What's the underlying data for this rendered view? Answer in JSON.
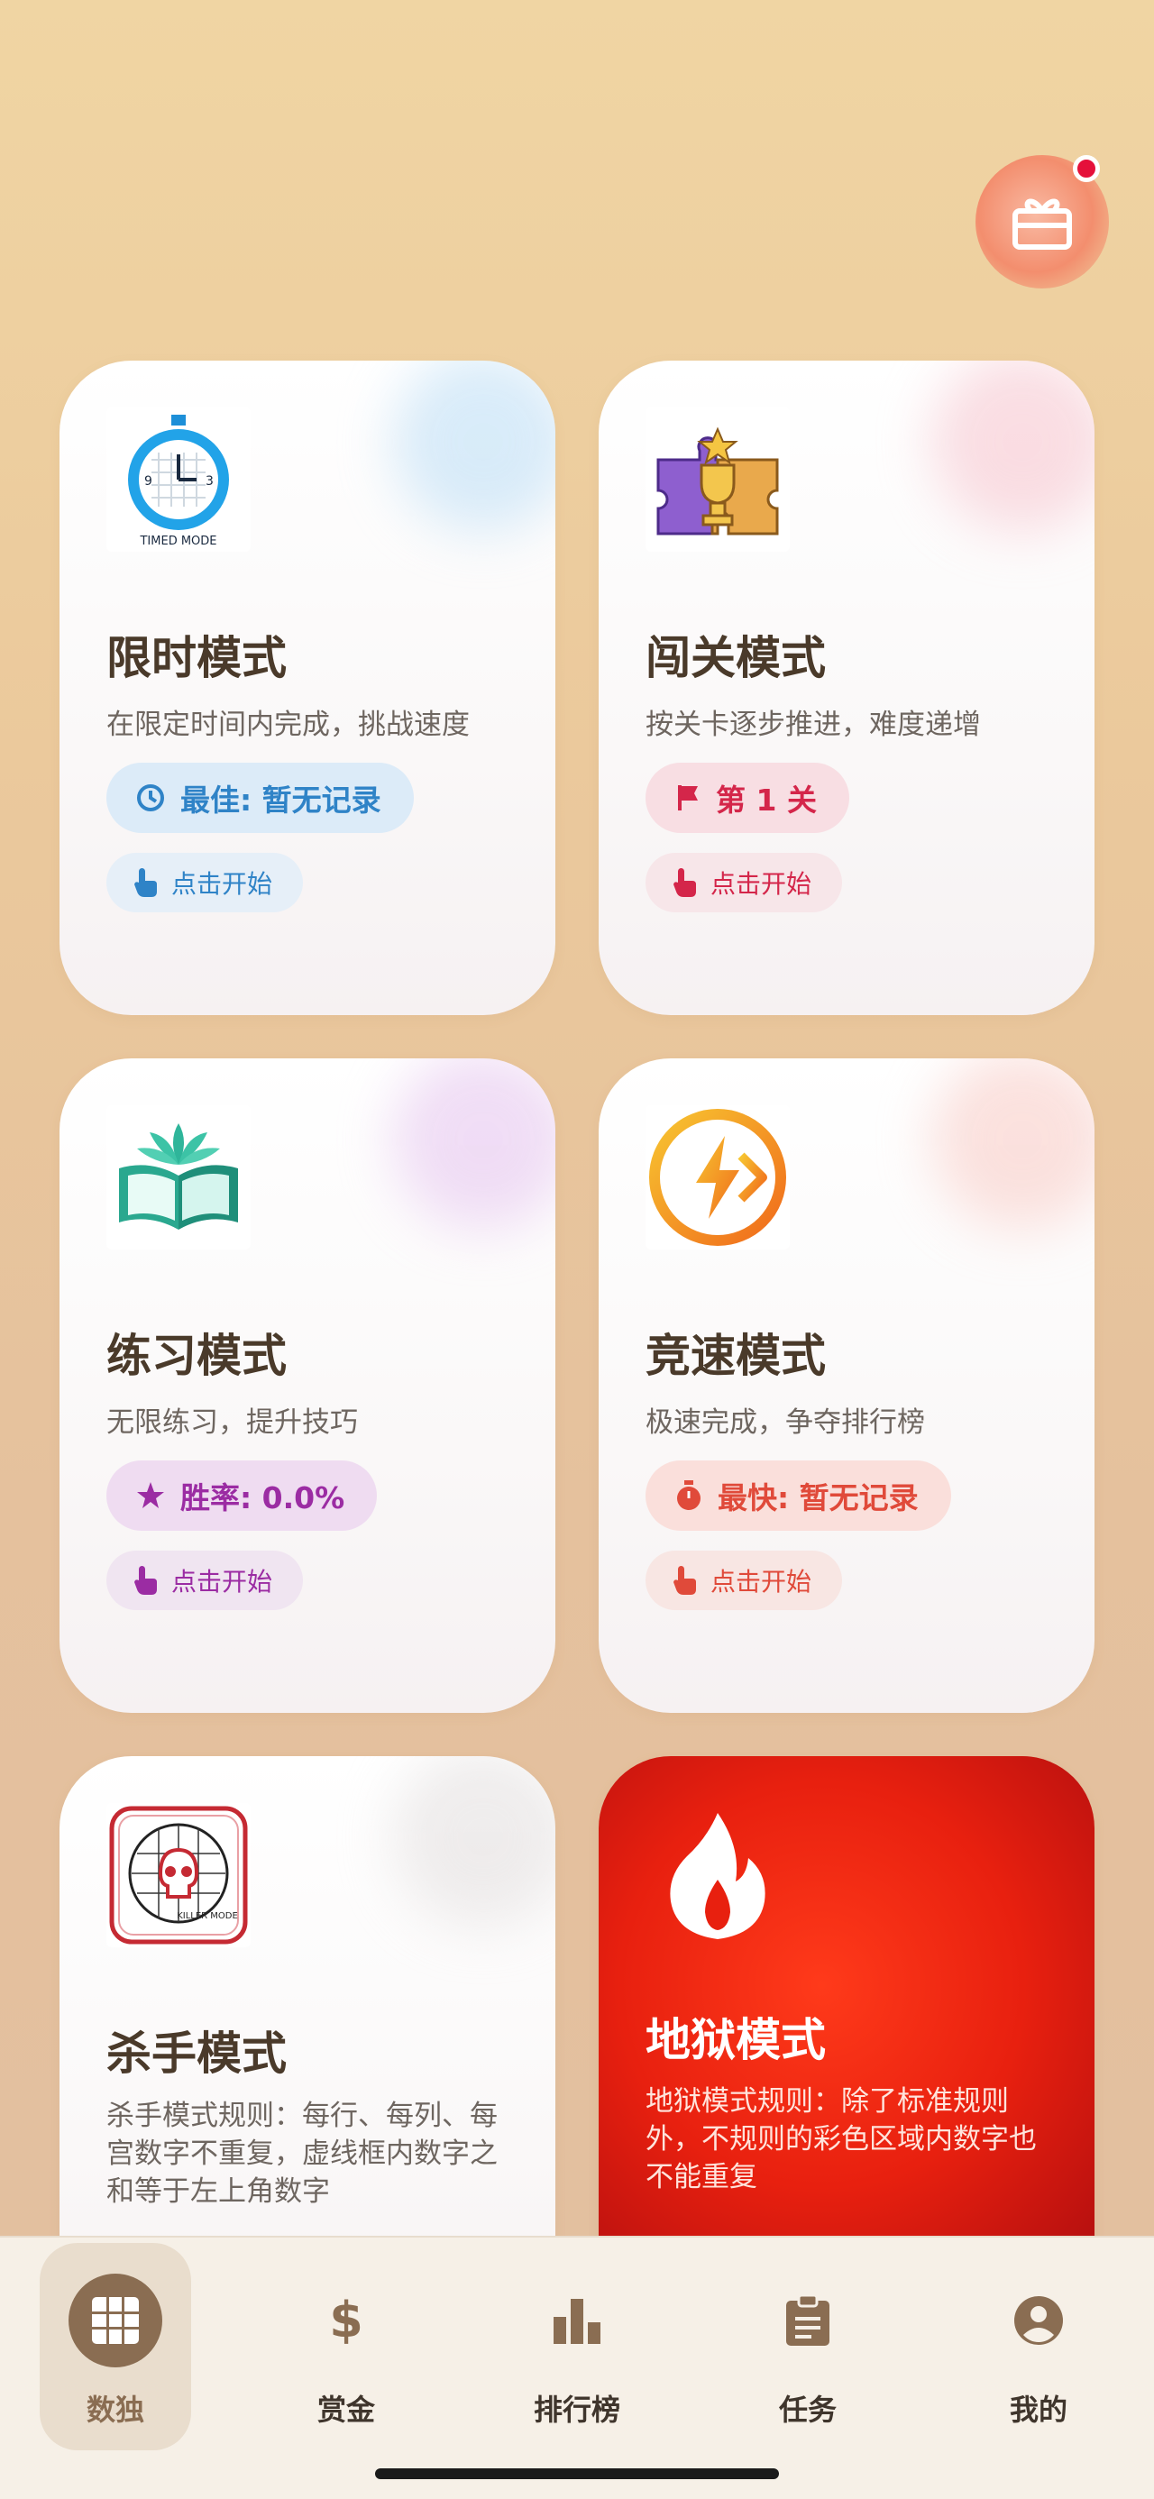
{
  "gift": {
    "icon": "gift-icon",
    "badge_color": "#e5103a"
  },
  "modes": [
    {
      "title": "限时模式",
      "desc": "在限定时间内完成，挑战速度",
      "badge": "最佳: 暂无记录",
      "badge_icon": "clock-icon",
      "start": "点击开始",
      "icon": "stopwatch-grid-icon",
      "icon_caption": "TIMED MODE",
      "accent": "#2f83c7"
    },
    {
      "title": "闯关模式",
      "desc": "按关卡逐步推进，难度递增",
      "badge": "第 1 关",
      "badge_icon": "flag-icon",
      "start": "点击开始",
      "icon": "puzzle-trophy-icon",
      "accent": "#d4264a"
    },
    {
      "title": "练习模式",
      "desc": "无限练习，提升技巧",
      "badge": "胜率: 0.0%",
      "badge_icon": "star-icon",
      "start": "点击开始",
      "icon": "lotus-book-icon",
      "accent": "#9b2ca3"
    },
    {
      "title": "竞速模式",
      "desc": "极速完成，争夺排行榜",
      "badge": "最快: 暂无记录",
      "badge_icon": "timer-icon",
      "start": "点击开始",
      "icon": "lightning-play-icon",
      "accent": "#e04a3a"
    },
    {
      "title": "杀手模式",
      "desc": "杀手模式规则：每行、每列、每宫数字不重复，虚线框内数字之和等于左上角数字",
      "icon": "skull-grid-icon",
      "icon_caption": "KILLER MODE"
    },
    {
      "title": "地狱模式",
      "desc": "地狱模式规则：除了标准规则外，不规则的彩色区域内数字也不能重复",
      "icon": "flame-icon"
    }
  ],
  "nav": [
    {
      "label": "数独",
      "icon": "grid-icon",
      "active": true
    },
    {
      "label": "赏金",
      "icon": "dollar-icon",
      "active": false
    },
    {
      "label": "排行榜",
      "icon": "bar-chart-icon",
      "active": false
    },
    {
      "label": "任务",
      "icon": "clipboard-icon",
      "active": false
    },
    {
      "label": "我的",
      "icon": "account-icon",
      "active": false
    }
  ]
}
